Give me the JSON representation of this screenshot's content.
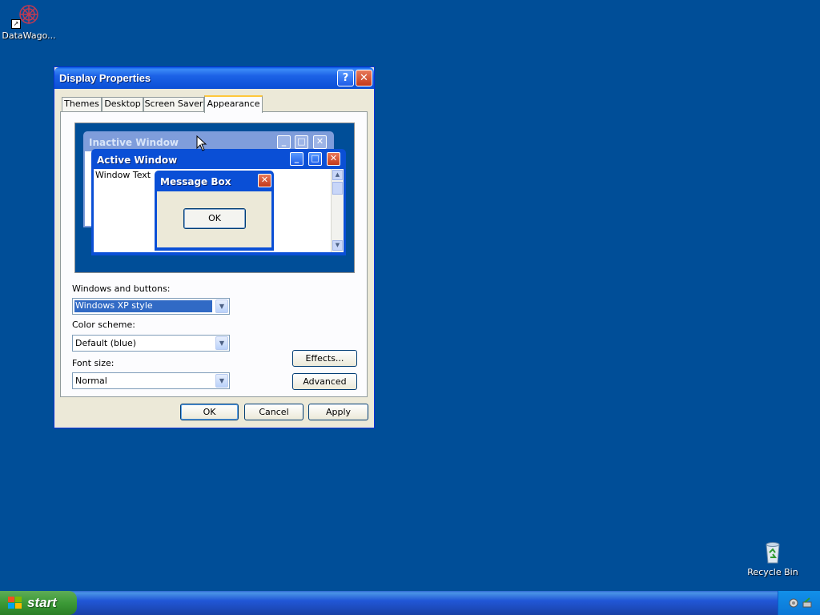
{
  "desktop": {
    "icons": [
      {
        "label": "DataWago..."
      },
      {
        "label": "Recycle Bin"
      }
    ]
  },
  "window": {
    "title": "Display Properties",
    "tabs": [
      "Themes",
      "Desktop",
      "Screen Saver",
      "Appearance"
    ],
    "active_tab": "Appearance",
    "preview": {
      "inactive_title": "Inactive Window",
      "active_title": "Active Window",
      "window_text": "Window Text",
      "message_title": "Message Box",
      "message_ok": "OK"
    },
    "windows_buttons_label": "Windows and buttons:",
    "windows_buttons_value": "Windows XP style",
    "color_scheme_label": "Color scheme:",
    "color_scheme_value": "Default (blue)",
    "font_size_label": "Font size:",
    "font_size_value": "Normal",
    "effects_button": "Effects...",
    "advanced_button": "Advanced",
    "ok_button": "OK",
    "cancel_button": "Cancel",
    "apply_button": "Apply"
  },
  "taskbar": {
    "start_label": "start"
  }
}
